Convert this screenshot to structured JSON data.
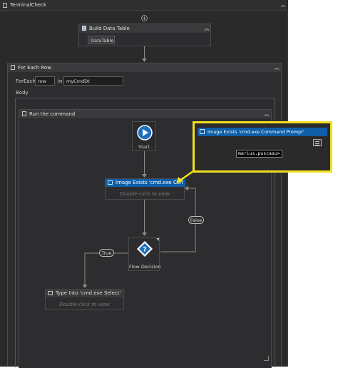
{
  "window": {
    "title": "TerminalCheck"
  },
  "build_data_table": {
    "title": "Build Data Table",
    "button_label": "DataTable..."
  },
  "for_each_row": {
    "title": "For Each Row",
    "foreach_label": "ForEach",
    "item_var": "row",
    "in_label": "in",
    "collection": "myCmdDt",
    "body_label": "Body"
  },
  "flowchart": {
    "title": "Run the command",
    "start_label": "Start",
    "image_exists": {
      "title": "Image Exists 'cmd.exe  Con",
      "hint": "Double-click to view"
    },
    "flow_decision": {
      "label": "Flow Decision",
      "symbol": "?"
    },
    "true_label": "True",
    "false_label": "False",
    "type_into": {
      "title": "Type Into 'cmd.exe Select'",
      "hint": "Double-click to view"
    }
  },
  "callout": {
    "title": "Image Exists 'cmd.exe  Command Prompt'",
    "preview_text": "marius.puscasu>"
  },
  "colors": {
    "accent_blue": "#0e5ea8",
    "highlight_yellow": "#f0e020",
    "canvas_bg": "#2a2a2b"
  }
}
